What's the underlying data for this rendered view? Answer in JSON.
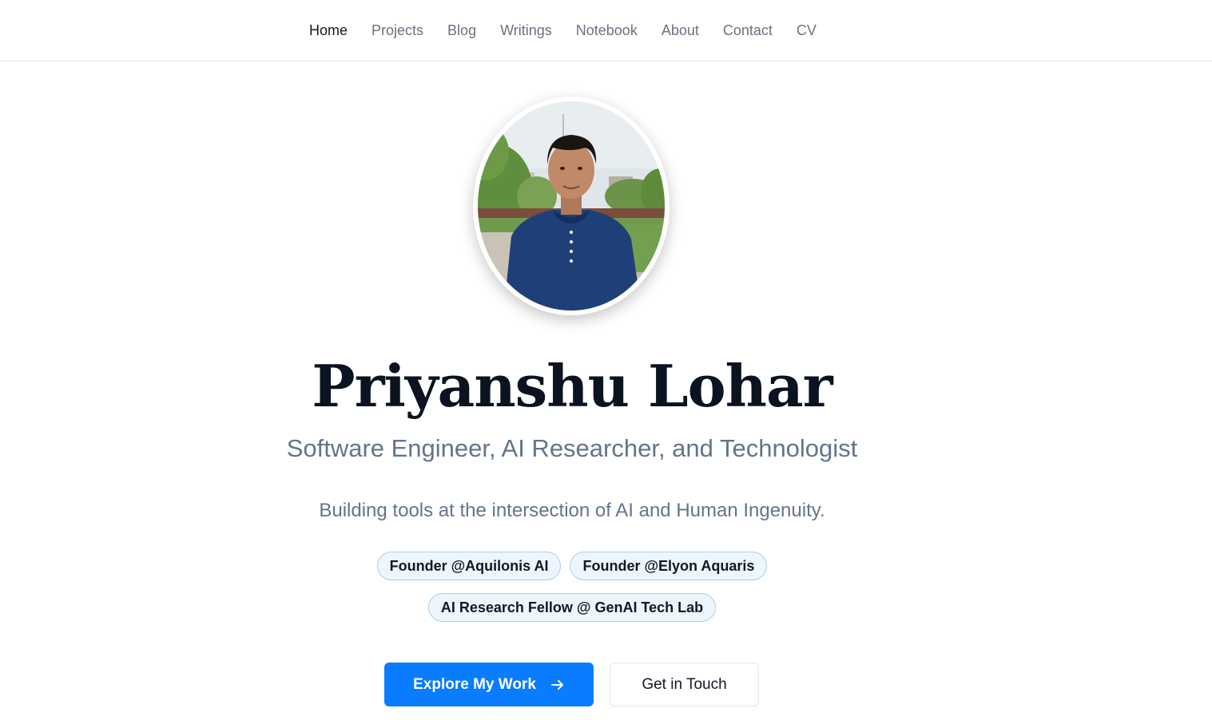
{
  "nav": {
    "items": [
      {
        "label": "Home",
        "active": true
      },
      {
        "label": "Projects",
        "active": false
      },
      {
        "label": "Blog",
        "active": false
      },
      {
        "label": "Writings",
        "active": false
      },
      {
        "label": "Notebook",
        "active": false
      },
      {
        "label": "About",
        "active": false
      },
      {
        "label": "Contact",
        "active": false
      },
      {
        "label": "CV",
        "active": false
      }
    ]
  },
  "hero": {
    "name": "Priyanshu Lohar",
    "subtitle": "Software Engineer, AI Researcher, and Technologist",
    "tagline": "Building tools at the intersection of AI and Human Ingenuity.",
    "badges": [
      "Founder @Aquilonis AI",
      "Founder @Elyon Aquaris",
      "AI Research Fellow @ GenAI Tech Lab"
    ],
    "primary_button": {
      "label": "Explore My Work",
      "icon": "arrow-right-icon"
    },
    "secondary_button": {
      "label": "Get in Touch"
    }
  },
  "colors": {
    "accent": "#0a7cff",
    "heading": "#0b1220",
    "muted": "#64748b",
    "badge_bg": "#eef6fd",
    "badge_border": "#a9cdf2"
  }
}
